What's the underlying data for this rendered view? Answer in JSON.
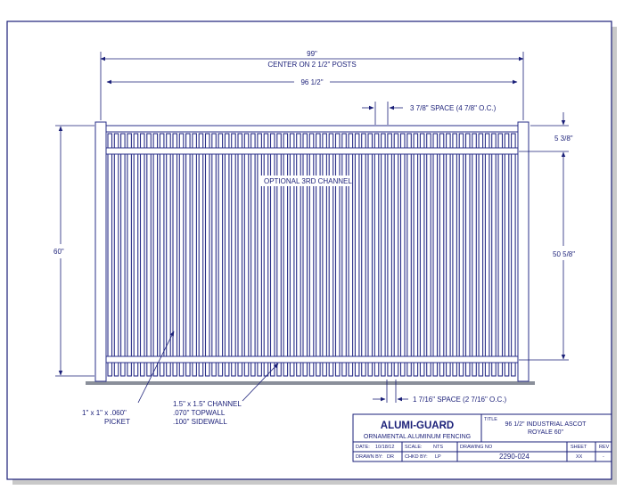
{
  "drawing": {
    "dim_total_width": "99\"",
    "dim_total_width_note": "CENTER ON 2 1/2\" POSTS",
    "dim_panel_width": "96 1/2\"",
    "dim_top_space": "3 7/8\" SPACE (4 7/8\" O.C.)",
    "dim_top_height": "5 3/8\"",
    "dim_mid_height": "50 5/8\"",
    "dim_overall_height": "60\"",
    "dim_bottom_space": "1 7/16\" SPACE (2 7/16\" O.C.)",
    "label_optional_channel": "OPTIONAL 3RD CHANNEL",
    "picket_label": [
      "1\" x 1\" x .060\"",
      "PICKET"
    ],
    "channel_label": [
      "1.5\" x 1.5\" CHANNEL",
      ".070\" TOPWALL",
      ".100\" SIDEWALL"
    ],
    "colors": {
      "ink": "#1a1f78",
      "ground": "#8a8f9a"
    }
  },
  "title_block": {
    "company": "ALUMI-GUARD",
    "subtitle": "ORNAMENTAL ALUMINUM FENCING",
    "title_label": "TITLE",
    "title_line1": "96 1/2\" INDUSTRIAL ASCOT",
    "title_line2": "ROYALE 60\"",
    "date_label": "DATE:",
    "date_value": "10/18/12",
    "scale_label": "SCALE:",
    "scale_value": "NTS",
    "drawing_no_label": "DRAWING NO",
    "drawing_no_value": "2290-024",
    "sheet_label": "SHEET",
    "sheet_value": "XX",
    "rev_label": "REV",
    "rev_value": "-",
    "drawn_by_label": "DRAWN BY:",
    "drawn_by_value": "DR",
    "chkd_by_label": "CHKD BY:",
    "chkd_by_value": "LP"
  }
}
